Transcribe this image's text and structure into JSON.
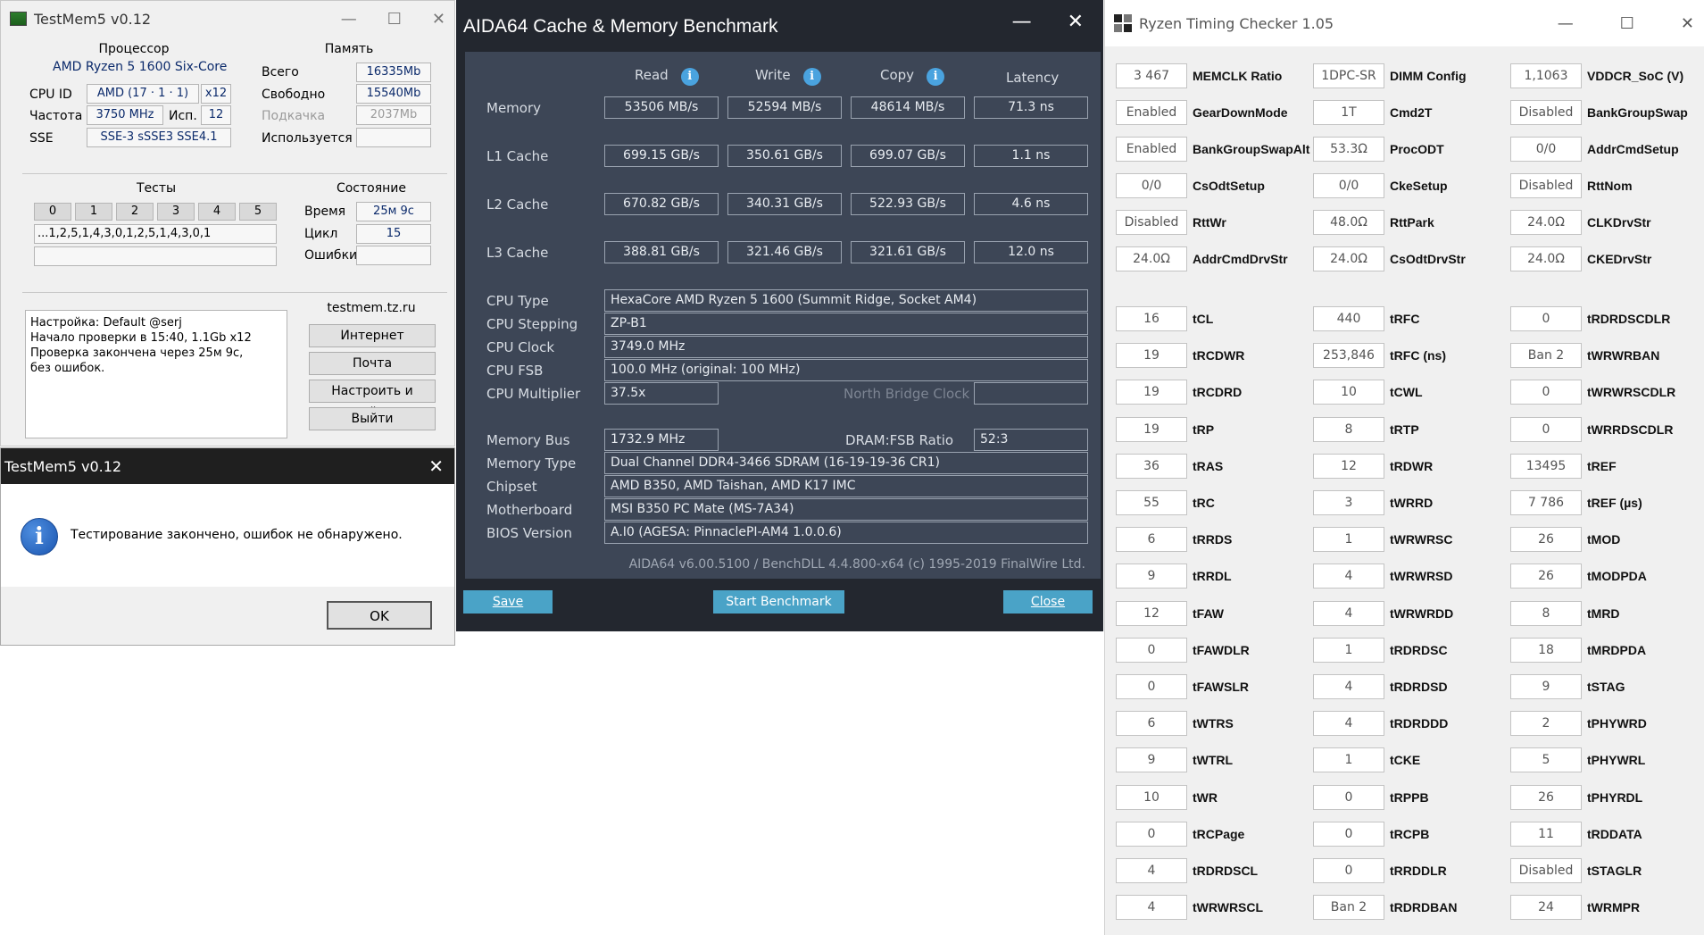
{
  "testmem": {
    "title": "TestMem5 v0.12",
    "cpu_group": "Процессор",
    "cpu_name": "AMD Ryzen 5 1600 Six-Core",
    "cpu_id_label": "CPU ID",
    "cpu_id": "AMD (17 · 1 · 1)",
    "cpu_threads": "x12",
    "freq_label": "Частота",
    "freq": "3750 MHz",
    "used_label": "Исп.",
    "used": "12",
    "sse_label": "SSE",
    "sse": "SSE-3 sSSE3 SSE4.1",
    "mem_group": "Память",
    "total_label": "Всего",
    "total": "16335Mb",
    "free_label": "Свободно",
    "free": "15540Mb",
    "swap_label": "Подкачка",
    "swap": "2037Mb",
    "inuse_label": "Используется",
    "inuse": "",
    "tests_group": "Тесты",
    "tests": [
      "0",
      "1",
      "2",
      "3",
      "4",
      "5"
    ],
    "sequence": "...1,2,5,1,4,3,0,1,2,5,1,4,3,0,1",
    "state_group": "Состояние",
    "time_label": "Время",
    "time": "25м 9с",
    "cycle_label": "Цикл",
    "cycle": "15",
    "errors_label": "Ошибки",
    "errors": "",
    "log": "Настройка: Default @serj\nНачало проверки в 15:40, 1.1Gb x12\nПроверка закончена через 25м 9с,\nбез ошибок.",
    "site": "testmem.tz.ru",
    "btn_internet": "Интернет",
    "btn_mail": "Почта",
    "btn_configure": "Настроить и выйти",
    "btn_exit": "Выйти"
  },
  "dialog": {
    "title": "TestMem5 v0.12",
    "message": "Тестирование закончено, ошибок не обнаружено.",
    "ok": "OK",
    "icon": "info-icon"
  },
  "aida": {
    "title": "AIDA64 Cache & Memory Benchmark",
    "headers": {
      "read": "Read",
      "write": "Write",
      "copy": "Copy",
      "latency": "Latency"
    },
    "rows": [
      {
        "label": "Memory",
        "read": "53506 MB/s",
        "write": "52594 MB/s",
        "copy": "48614 MB/s",
        "latency": "71.3 ns"
      },
      {
        "label": "L1 Cache",
        "read": "699.15 GB/s",
        "write": "350.61 GB/s",
        "copy": "699.07 GB/s",
        "latency": "1.1 ns"
      },
      {
        "label": "L2 Cache",
        "read": "670.82 GB/s",
        "write": "340.31 GB/s",
        "copy": "522.93 GB/s",
        "latency": "4.6 ns"
      },
      {
        "label": "L3 Cache",
        "read": "388.81 GB/s",
        "write": "321.46 GB/s",
        "copy": "321.61 GB/s",
        "latency": "12.0 ns"
      }
    ],
    "cpu_type_label": "CPU Type",
    "cpu_type": "HexaCore AMD Ryzen 5 1600  (Summit Ridge, Socket AM4)",
    "cpu_stepping_label": "CPU Stepping",
    "cpu_stepping": "ZP-B1",
    "cpu_clock_label": "CPU Clock",
    "cpu_clock": "3749.0 MHz",
    "cpu_fsb_label": "CPU FSB",
    "cpu_fsb": "100.0 MHz  (original: 100 MHz)",
    "cpu_mult_label": "CPU Multiplier",
    "cpu_mult": "37.5x",
    "nb_clock_label": "North Bridge Clock",
    "nb_clock": "",
    "mem_bus_label": "Memory Bus",
    "mem_bus": "1732.9 MHz",
    "dram_ratio_label": "DRAM:FSB Ratio",
    "dram_ratio": "52:3",
    "mem_type_label": "Memory Type",
    "mem_type": "Dual Channel DDR4-3466 SDRAM  (16-19-19-36 CR1)",
    "chipset_label": "Chipset",
    "chipset": "AMD B350, AMD Taishan, AMD K17 IMC",
    "mobo_label": "Motherboard",
    "mobo": "MSI B350 PC Mate (MS-7A34)",
    "bios_label": "BIOS Version",
    "bios": "A.I0  (AGESA: PinnaclePI-AM4 1.0.0.6)",
    "footer": "AIDA64 v6.00.5100 / BenchDLL 4.4.800-x64  (c) 1995-2019 FinalWire Ltd.",
    "btn_save": "Save",
    "btn_start": "Start Benchmark",
    "btn_close": "Close"
  },
  "rtc": {
    "title": "Ryzen Timing Checker 1.05",
    "top_rows": [
      [
        {
          "v": "3 467",
          "l": "MEMCLK Ratio"
        },
        {
          "v": "1DPC-SR",
          "l": "DIMM Config"
        },
        {
          "v": "1,1063",
          "l": "VDDCR_SoC (V)"
        }
      ],
      [
        {
          "v": "Enabled",
          "l": "GearDownMode"
        },
        {
          "v": "1T",
          "l": "Cmd2T"
        },
        {
          "v": "Disabled",
          "l": "BankGroupSwap"
        }
      ],
      [
        {
          "v": "Enabled",
          "l": "BankGroupSwapAlt"
        },
        {
          "v": "53.3Ω",
          "l": "ProcODT"
        },
        {
          "v": "0/0",
          "l": "AddrCmdSetup"
        }
      ],
      [
        {
          "v": "0/0",
          "l": "CsOdtSetup"
        },
        {
          "v": "0/0",
          "l": "CkeSetup"
        },
        {
          "v": "Disabled",
          "l": "RttNom"
        }
      ],
      [
        {
          "v": "Disabled",
          "l": "RttWr"
        },
        {
          "v": "48.0Ω",
          "l": "RttPark"
        },
        {
          "v": "24.0Ω",
          "l": "CLKDrvStr"
        }
      ],
      [
        {
          "v": "24.0Ω",
          "l": "AddrCmdDrvStr"
        },
        {
          "v": "24.0Ω",
          "l": "CsOdtDrvStr"
        },
        {
          "v": "24.0Ω",
          "l": "CKEDrvStr"
        }
      ]
    ],
    "timing_rows": [
      [
        {
          "v": "16",
          "l": "tCL"
        },
        {
          "v": "440",
          "l": "tRFC"
        },
        {
          "v": "0",
          "l": "tRDRDSCDLR"
        }
      ],
      [
        {
          "v": "19",
          "l": "tRCDWR"
        },
        {
          "v": "253,846",
          "l": "tRFC (ns)"
        },
        {
          "v": "Ban 2",
          "l": "tWRWRBAN"
        }
      ],
      [
        {
          "v": "19",
          "l": "tRCDRD"
        },
        {
          "v": "10",
          "l": "tCWL"
        },
        {
          "v": "0",
          "l": "tWRWRSCDLR"
        }
      ],
      [
        {
          "v": "19",
          "l": "tRP"
        },
        {
          "v": "8",
          "l": "tRTP"
        },
        {
          "v": "0",
          "l": "tWRRDSCDLR"
        }
      ],
      [
        {
          "v": "36",
          "l": "tRAS"
        },
        {
          "v": "12",
          "l": "tRDWR"
        },
        {
          "v": "13495",
          "l": "tREF"
        }
      ],
      [
        {
          "v": "55",
          "l": "tRC"
        },
        {
          "v": "3",
          "l": "tWRRD"
        },
        {
          "v": "7 786",
          "l": "tREF (µs)"
        }
      ],
      [
        {
          "v": "6",
          "l": "tRRDS"
        },
        {
          "v": "1",
          "l": "tWRWRSC"
        },
        {
          "v": "26",
          "l": "tMOD"
        }
      ],
      [
        {
          "v": "9",
          "l": "tRRDL"
        },
        {
          "v": "4",
          "l": "tWRWRSD"
        },
        {
          "v": "26",
          "l": "tMODPDA"
        }
      ],
      [
        {
          "v": "12",
          "l": "tFAW"
        },
        {
          "v": "4",
          "l": "tWRWRDD"
        },
        {
          "v": "8",
          "l": "tMRD"
        }
      ],
      [
        {
          "v": "0",
          "l": "tFAWDLR"
        },
        {
          "v": "1",
          "l": "tRDRDSC"
        },
        {
          "v": "18",
          "l": "tMRDPDA"
        }
      ],
      [
        {
          "v": "0",
          "l": "tFAWSLR"
        },
        {
          "v": "4",
          "l": "tRDRDSD"
        },
        {
          "v": "9",
          "l": "tSTAG"
        }
      ],
      [
        {
          "v": "6",
          "l": "tWTRS"
        },
        {
          "v": "4",
          "l": "tRDRDDD"
        },
        {
          "v": "2",
          "l": "tPHYWRD"
        }
      ],
      [
        {
          "v": "9",
          "l": "tWTRL"
        },
        {
          "v": "1",
          "l": "tCKE"
        },
        {
          "v": "5",
          "l": "tPHYWRL"
        }
      ],
      [
        {
          "v": "10",
          "l": "tWR"
        },
        {
          "v": "0",
          "l": "tRPPB"
        },
        {
          "v": "26",
          "l": "tPHYRDL"
        }
      ],
      [
        {
          "v": "0",
          "l": "tRCPage"
        },
        {
          "v": "0",
          "l": "tRCPB"
        },
        {
          "v": "11",
          "l": "tRDDATA"
        }
      ],
      [
        {
          "v": "4",
          "l": "tRDRDSCL"
        },
        {
          "v": "0",
          "l": "tRRDDLR"
        },
        {
          "v": "Disabled",
          "l": "tSTAGLR"
        }
      ],
      [
        {
          "v": "4",
          "l": "tWRWRSCL"
        },
        {
          "v": "Ban 2",
          "l": "tRDRDBAN"
        },
        {
          "v": "24",
          "l": "tWRMPR"
        }
      ]
    ]
  }
}
